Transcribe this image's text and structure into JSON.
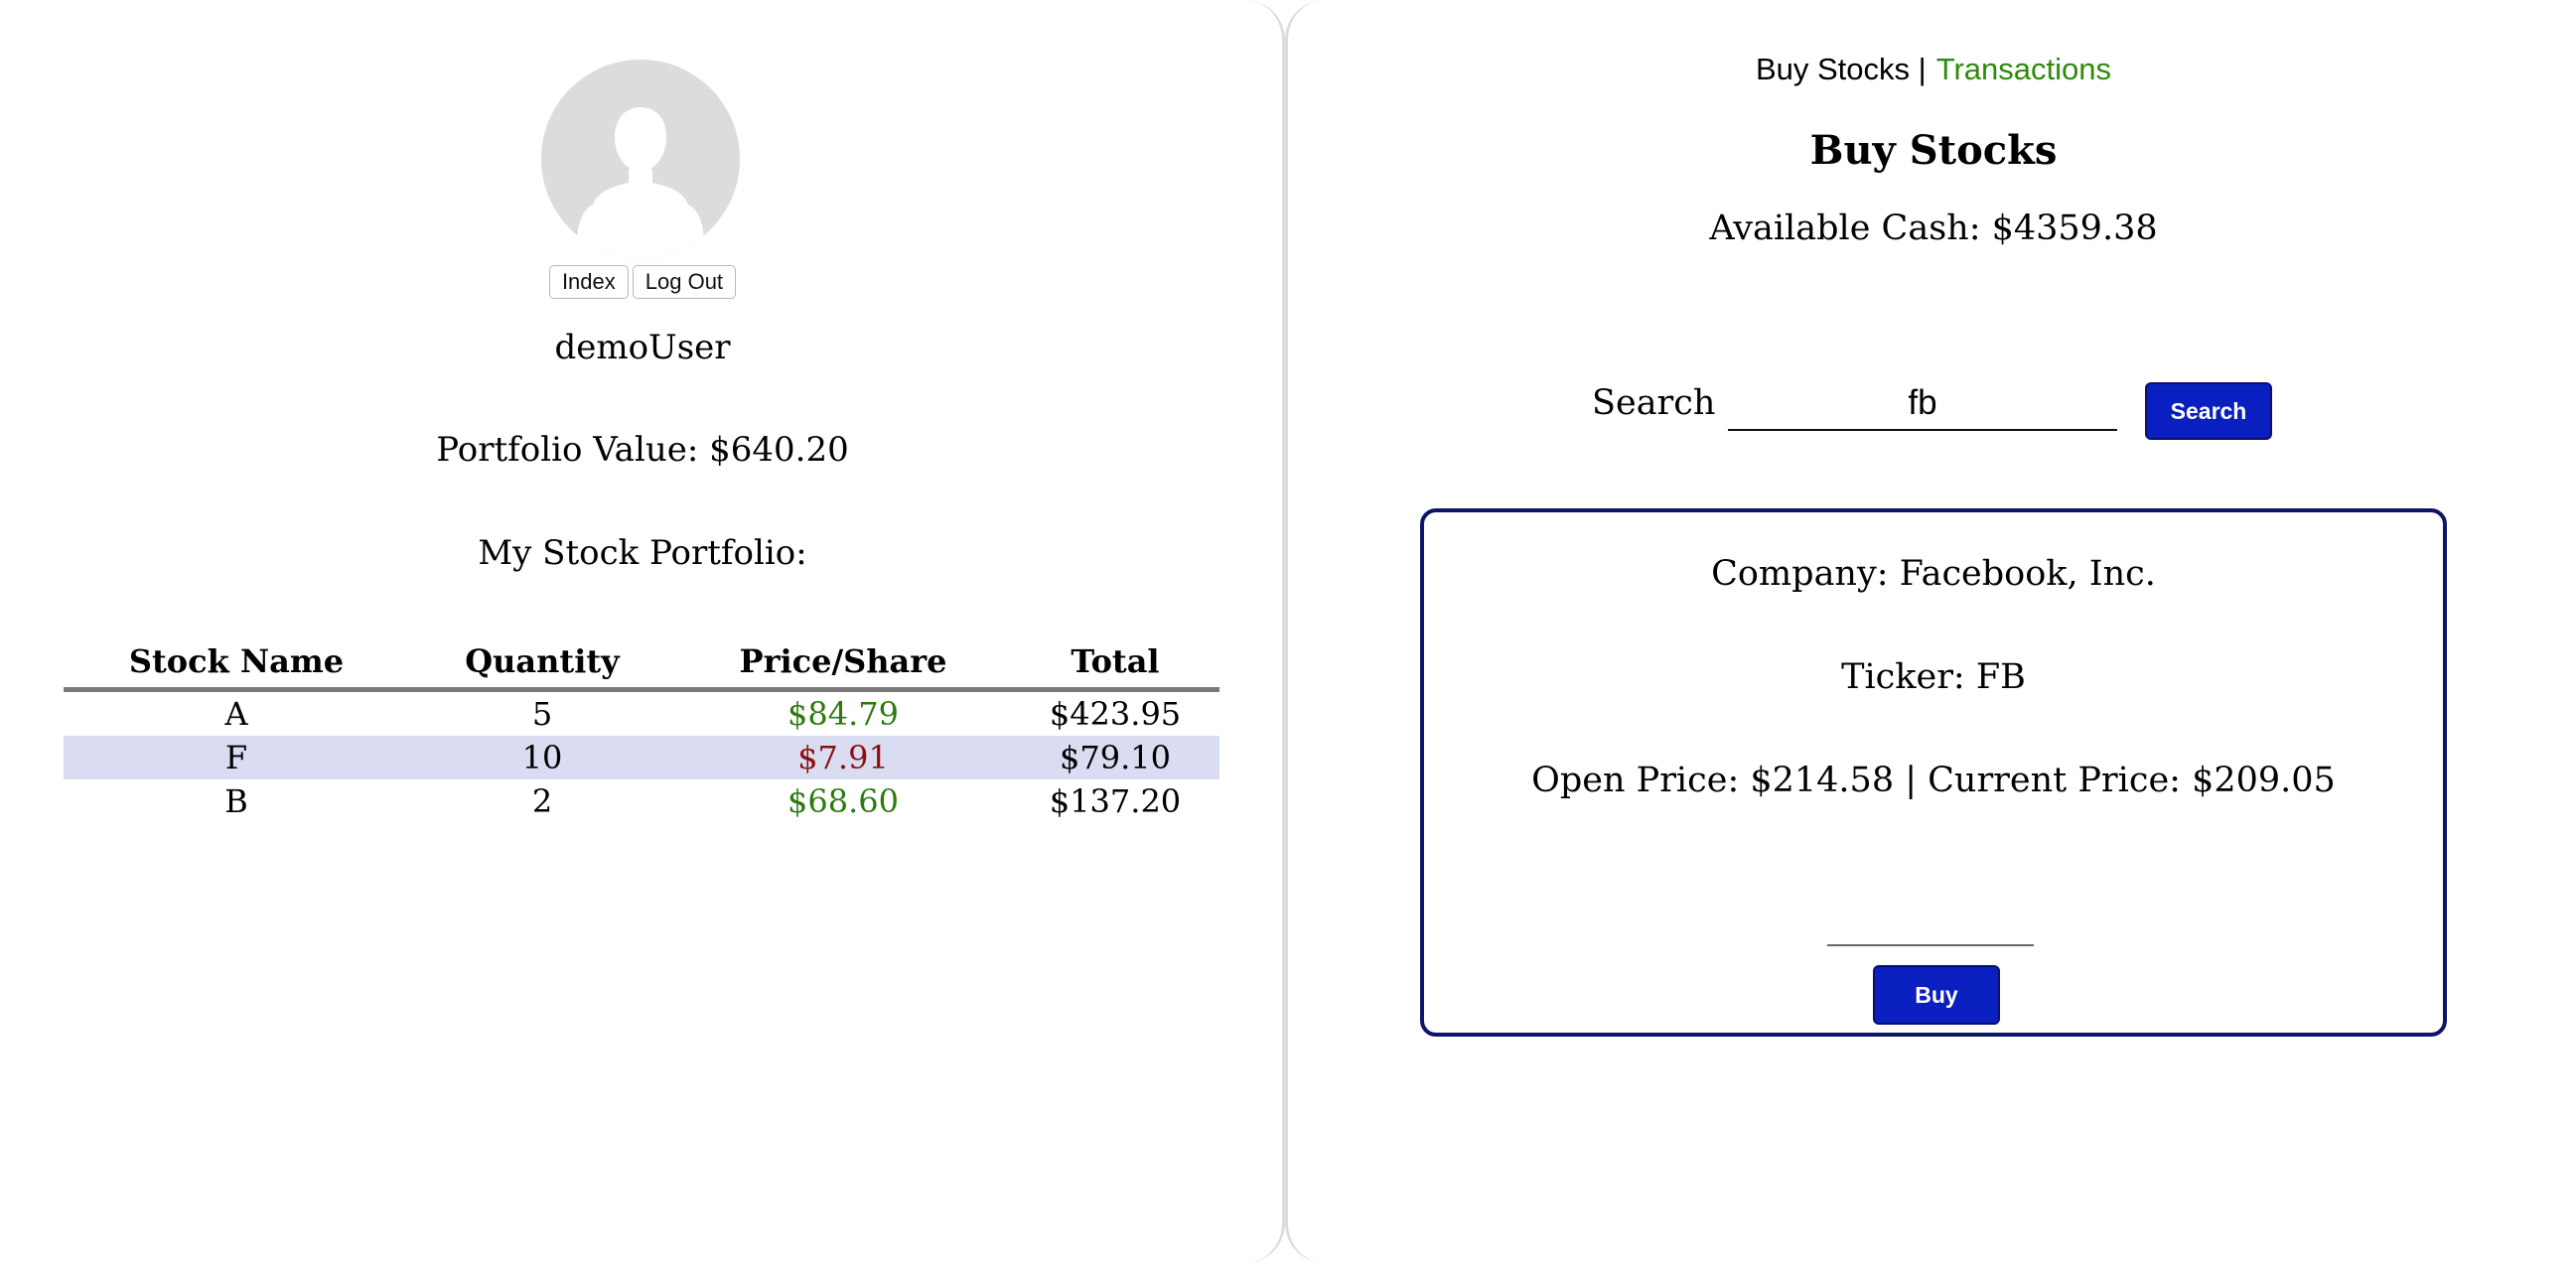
{
  "sidebar": {
    "nav_buttons": {
      "index": "Index",
      "logout": "Log Out"
    },
    "username": "demoUser",
    "portfolio_value": "Portfolio Value: $640.20",
    "portfolio_title": "My Stock Portfolio:",
    "table": {
      "headers": [
        "Stock Name",
        "Quantity",
        "Price/Share",
        "Total"
      ],
      "rows": [
        {
          "name": "A",
          "quantity": "5",
          "price": "$84.79",
          "price_trend": "up",
          "total": "$423.95"
        },
        {
          "name": "F",
          "quantity": "10",
          "price": "$7.91",
          "price_trend": "down",
          "total": "$79.10"
        },
        {
          "name": "B",
          "quantity": "2",
          "price": "$68.60",
          "price_trend": "up",
          "total": "$137.20"
        }
      ]
    }
  },
  "main": {
    "nav": {
      "current": "Buy Stocks |",
      "other": "Transactions"
    },
    "title": "Buy Stocks",
    "available_cash": "Available Cash: $4359.38",
    "search": {
      "label": "Search",
      "value": "fb",
      "button": "Search"
    },
    "result": {
      "company": "Company: Facebook, Inc.",
      "ticker": "Ticker: FB",
      "prices": "Open Price: $214.58 | Current Price: $209.05",
      "quantity_value": "",
      "buy_button": "Buy"
    }
  },
  "colors": {
    "up": "#2e7a0f",
    "down": "#8a0f0f",
    "accent_button": "#0a1fbf",
    "card_border": "#0d1566",
    "link": "#2e8a0c",
    "row_highlight": "#dadcf2"
  },
  "icons": {
    "avatar": "user-silhouette-icon"
  }
}
